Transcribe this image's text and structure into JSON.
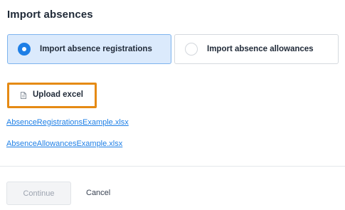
{
  "dialog": {
    "title": "Import absences"
  },
  "import_options": [
    {
      "label": "Import absence registrations",
      "selected": true,
      "icon": "radio-checked"
    },
    {
      "label": "Import absence allowances",
      "selected": false,
      "icon": "radio-unchecked"
    }
  ],
  "upload": {
    "label": "Upload excel",
    "icon": "file-icon",
    "highlight_color": "#e58a14"
  },
  "example_links": [
    "AbsenceRegistrationsExample.xlsx",
    "AbsenceAllowancesExample.xlsx"
  ],
  "footer": {
    "continue_label": "Continue",
    "continue_disabled": true,
    "cancel_label": "Cancel"
  },
  "colors": {
    "accent": "#1e7fe6",
    "selected_bg": "#dbeafc",
    "link": "#1e7fe6"
  }
}
